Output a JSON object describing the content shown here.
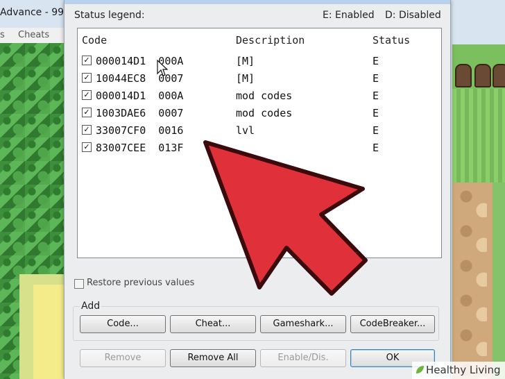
{
  "background": {
    "left_window_title": "Advance - 99",
    "left_menu": [
      "s",
      "Cheats"
    ]
  },
  "dialog": {
    "legend_label": "Status legend:",
    "legend_enabled": "E: Enabled",
    "legend_disabled": "D: Disabled",
    "columns": {
      "code": "Code",
      "description": "Description",
      "status": "Status"
    },
    "cheats": [
      {
        "checked": true,
        "code": "000014D1  000A",
        "description": "[M]",
        "status": "E"
      },
      {
        "checked": true,
        "code": "10044EC8  0007",
        "description": "[M]",
        "status": "E"
      },
      {
        "checked": true,
        "code": "000014D1  000A",
        "description": "mod codes",
        "status": "E"
      },
      {
        "checked": true,
        "code": "1003DAE6  0007",
        "description": "mod codes",
        "status": "E"
      },
      {
        "checked": true,
        "code": "33007CF0  0016",
        "description": "lvl",
        "status": "E"
      },
      {
        "checked": true,
        "code": "83007CEE  013F",
        "description": "",
        "status": "E"
      }
    ],
    "restore_label": "Restore previous values",
    "add_label": "Add",
    "add_buttons": {
      "code": "Code...",
      "cheat": "Cheat...",
      "gameshark": "Gameshark...",
      "codebreaker": "CodeBreaker..."
    },
    "bottom_buttons": {
      "remove": "Remove",
      "remove_all": "Remove All",
      "enable_disable": "Enable/Dis.",
      "ok": "OK"
    }
  },
  "overlay": {
    "arrow_color": "#e0313a"
  },
  "watermark": {
    "text": "Healthy Living"
  }
}
